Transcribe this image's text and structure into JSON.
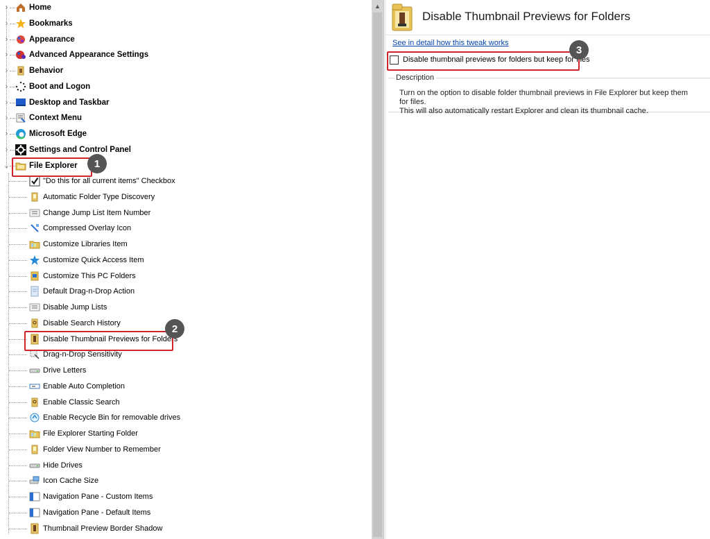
{
  "tree": {
    "categories": [
      {
        "label": "Home",
        "icon": "home-icon"
      },
      {
        "label": "Bookmarks",
        "icon": "star-icon"
      },
      {
        "label": "Appearance",
        "icon": "palette-icon"
      },
      {
        "label": "Advanced Appearance Settings",
        "icon": "palette-gear-icon"
      },
      {
        "label": "Behavior",
        "icon": "behavior-icon"
      },
      {
        "label": "Boot and Logon",
        "icon": "spinner-icon"
      },
      {
        "label": "Desktop and Taskbar",
        "icon": "desktop-icon"
      },
      {
        "label": "Context Menu",
        "icon": "context-menu-icon"
      },
      {
        "label": "Microsoft Edge",
        "icon": "edge-icon"
      },
      {
        "label": "Settings and Control Panel",
        "icon": "gear-icon"
      },
      {
        "label": "File Explorer",
        "icon": "folder-icon"
      }
    ],
    "items": [
      {
        "label": "\"Do this for all current items\" Checkbox",
        "icon": "checkmark-icon"
      },
      {
        "label": "Automatic Folder Type Discovery",
        "icon": "folder-doc-icon"
      },
      {
        "label": "Change Jump List Item Number",
        "icon": "list-icon"
      },
      {
        "label": "Compressed Overlay Icon",
        "icon": "arrows-icon"
      },
      {
        "label": "Customize Libraries Item",
        "icon": "library-icon"
      },
      {
        "label": "Customize Quick Access Item",
        "icon": "star-blue-icon"
      },
      {
        "label": "Customize This PC Folders",
        "icon": "pc-folder-icon"
      },
      {
        "label": "Default Drag-n-Drop Action",
        "icon": "document-icon"
      },
      {
        "label": "Disable Jump Lists",
        "icon": "list-icon"
      },
      {
        "label": "Disable Search History",
        "icon": "search-folder-icon"
      },
      {
        "label": "Disable Thumbnail Previews for Folders",
        "icon": "thumbnail-folder-icon"
      },
      {
        "label": "Drag-n-Drop Sensitivity",
        "icon": "drag-icon"
      },
      {
        "label": "Drive Letters",
        "icon": "drive-icon"
      },
      {
        "label": "Enable Auto Completion",
        "icon": "textbox-icon"
      },
      {
        "label": "Enable Classic Search",
        "icon": "search-folder-icon"
      },
      {
        "label": "Enable Recycle Bin for removable drives",
        "icon": "recycle-icon"
      },
      {
        "label": "File Explorer Starting Folder",
        "icon": "library-icon"
      },
      {
        "label": "Folder View Number to Remember",
        "icon": "folder-doc-icon"
      },
      {
        "label": "Hide Drives",
        "icon": "drive-icon"
      },
      {
        "label": "Icon Cache Size",
        "icon": "drive-cache-icon"
      },
      {
        "label": "Navigation Pane - Custom Items",
        "icon": "nav-pane-icon"
      },
      {
        "label": "Navigation Pane - Default Items",
        "icon": "nav-pane-icon"
      },
      {
        "label": "Thumbnail Preview Border Shadow",
        "icon": "thumbnail-folder-icon"
      }
    ]
  },
  "detail": {
    "title": "Disable Thumbnail Previews for Folders",
    "link": "See in detail how this tweak works",
    "option_label": "Disable thumbnail previews for folders but keep for files",
    "option_checked": false,
    "description_legend": "Description",
    "description_line1": "Turn on the option to disable folder thumbnail previews in File Explorer but keep them for files.",
    "description_line2": "This will also automatically restart Explorer and clean its thumbnail cache."
  },
  "callouts": [
    "1",
    "2",
    "3"
  ],
  "colors": {
    "highlight": "#d1232a",
    "badge": "#555555",
    "link": "#0645ad"
  }
}
